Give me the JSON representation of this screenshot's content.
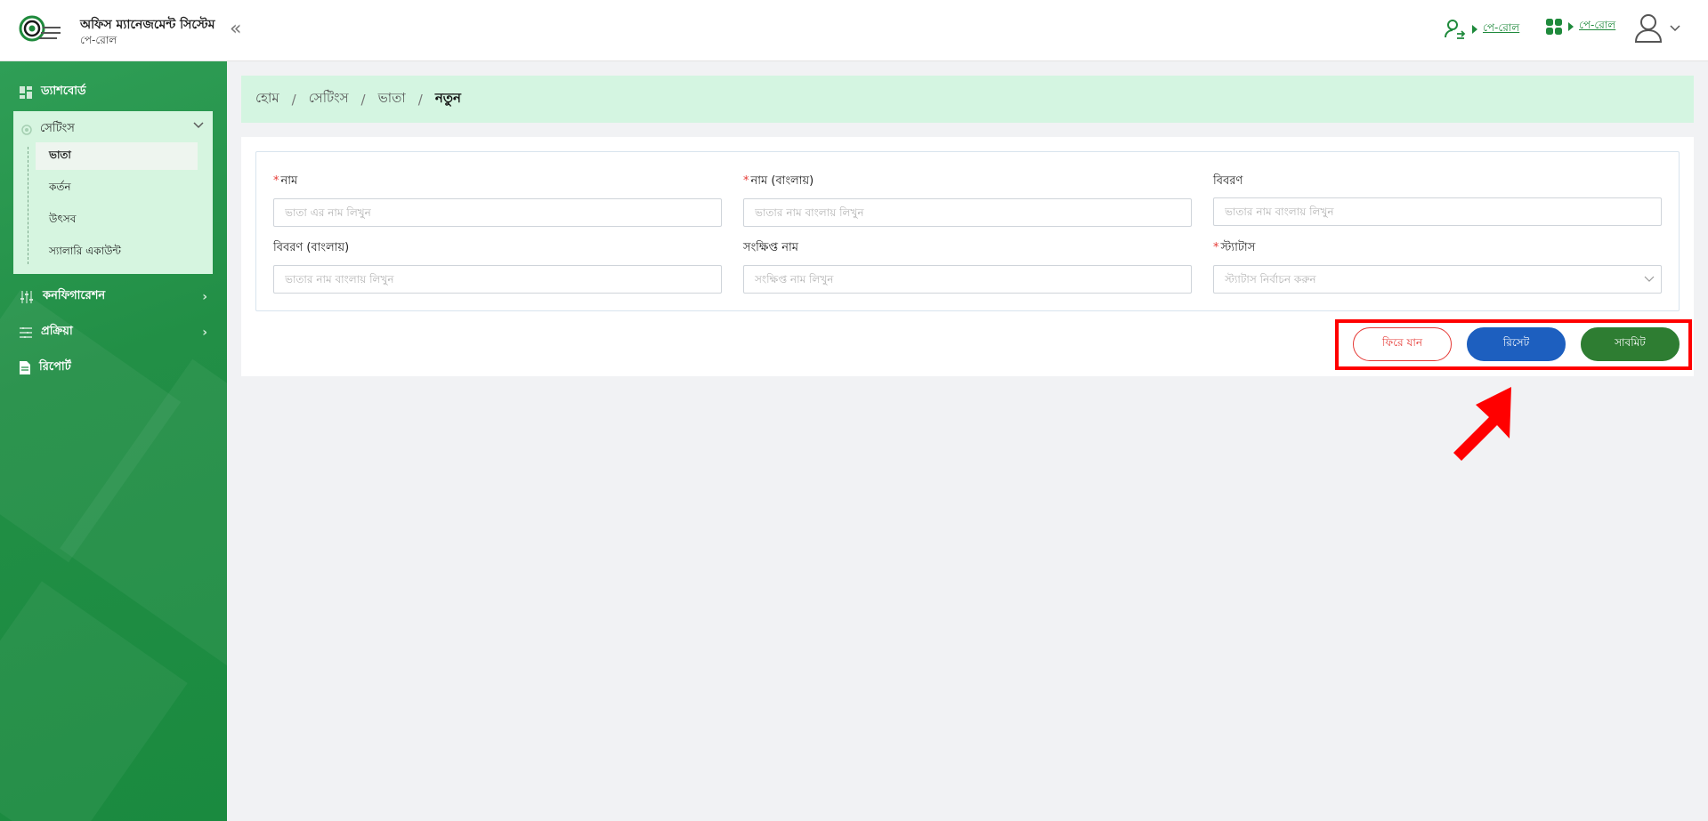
{
  "header": {
    "app_title": "অফিস ম্যানেজমেন্ট সিস্টেম",
    "app_subtitle": "পে-রোল",
    "collapse_icon": "«",
    "links": [
      {
        "icon": "user-switch-icon",
        "label": "পে-রোল"
      },
      {
        "icon": "apps-grid-icon",
        "label": "পে-রোল"
      }
    ],
    "user_icon": "user-avatar-icon"
  },
  "sidebar": {
    "items": [
      {
        "label": "ড্যাশবোর্ড",
        "icon": "dashboard-icon"
      },
      {
        "label": "সেটিংস",
        "icon": "settings-icon",
        "expanded": true
      },
      {
        "label": "কনফিগারেশন",
        "icon": "sliders-icon"
      },
      {
        "label": "প্রক্রিয়া",
        "icon": "list-icon"
      },
      {
        "label": "রিপোর্ট",
        "icon": "document-icon"
      }
    ],
    "settings_children": [
      {
        "label": "ভাতা",
        "active": true
      },
      {
        "label": "কর্তন"
      },
      {
        "label": "উৎসব"
      },
      {
        "label": "স্যালারি একাউন্ট"
      }
    ]
  },
  "breadcrumb": [
    "হোম",
    "সেটিংস",
    "ভাতা",
    "নতুন"
  ],
  "form": {
    "fields": [
      {
        "label": "নাম",
        "required": true,
        "placeholder": "ভাতা এর নাম লিখুন",
        "value": ""
      },
      {
        "label": "নাম (বাংলায়)",
        "required": true,
        "placeholder": "ভাতার নাম বাংলায় লিখুন",
        "value": ""
      },
      {
        "label": "বিবরণ",
        "required": false,
        "placeholder": "ভাতার নাম বাংলায় লিখুন",
        "value": ""
      },
      {
        "label": "বিবরণ (বাংলায়)",
        "required": false,
        "placeholder": "ভাতার নাম বাংলায় লিখুন",
        "value": ""
      },
      {
        "label": "সংক্ষিপ্ত নাম",
        "required": false,
        "placeholder": "সংক্ষিপ্ত নাম লিখুন",
        "value": ""
      },
      {
        "label": "স্ট্যাটাস",
        "required": true,
        "placeholder": "স্ট্যাটাস নির্বাচন করুন",
        "value": "",
        "type": "select"
      }
    ],
    "required_marker": "*"
  },
  "buttons": {
    "back": "ফিরে যান",
    "reset": "রিসেট",
    "submit": "সাবমিট"
  },
  "colors": {
    "brand_green": "#1f8a3c",
    "sidebar_green": "#228f46",
    "reset_blue": "#1d5fbf",
    "submit_green": "#2e7d32",
    "danger_red": "#e53935",
    "annotation_red": "#ff0000"
  }
}
